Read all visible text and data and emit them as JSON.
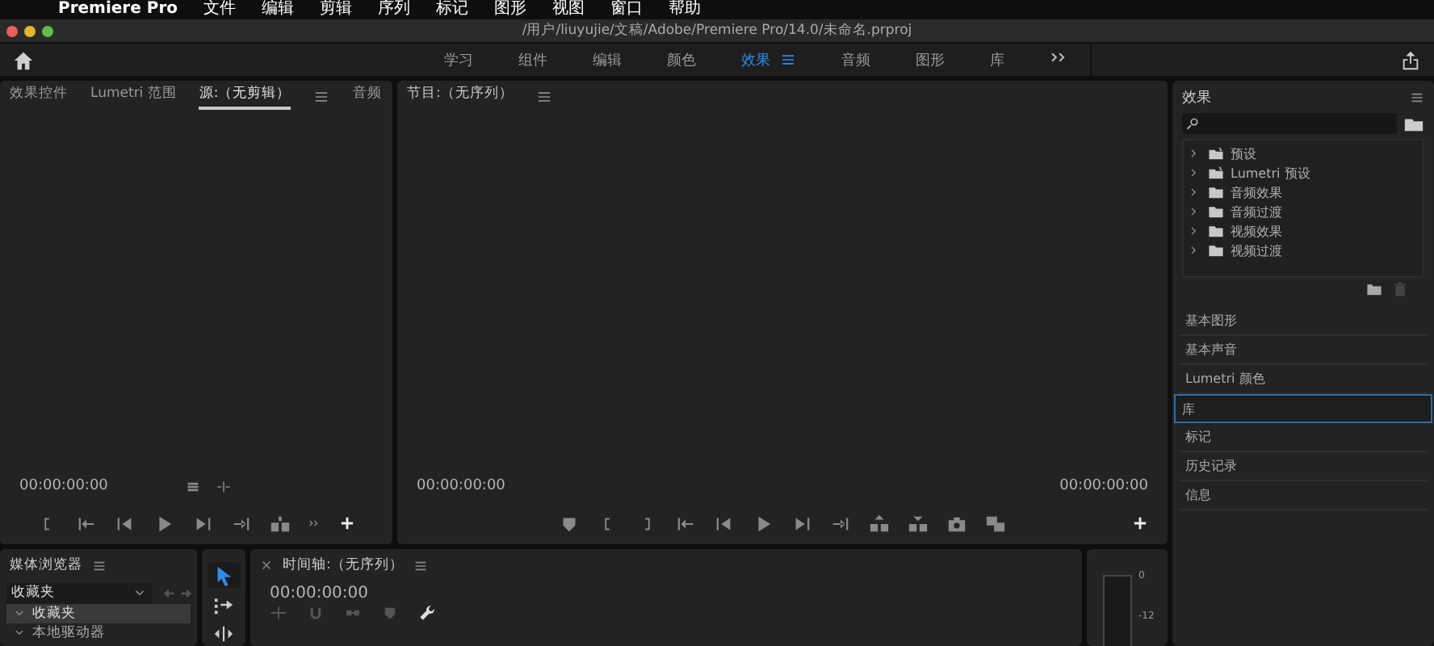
{
  "menu_bar": {
    "app_name": "Premiere Pro",
    "items": [
      "文件",
      "编辑",
      "剪辑",
      "序列",
      "标记",
      "图形",
      "视图",
      "窗口",
      "帮助"
    ]
  },
  "window": {
    "title": "/用户/liuyujie/文稿/Adobe/Premiere Pro/14.0/未命名.prproj"
  },
  "workspaces": [
    {
      "label": "学习",
      "selected": false
    },
    {
      "label": "组件",
      "selected": false
    },
    {
      "label": "编辑",
      "selected": false
    },
    {
      "label": "颜色",
      "selected": false
    },
    {
      "label": "效果",
      "selected": true
    },
    {
      "label": "音频",
      "selected": false
    },
    {
      "label": "图形",
      "selected": false
    },
    {
      "label": "库",
      "selected": false
    }
  ],
  "source_panel": {
    "tabs": [
      {
        "label": "效果控件",
        "selected": false
      },
      {
        "label": "Lumetri 范围",
        "selected": false
      },
      {
        "label": "源:（无剪辑）",
        "selected": true
      },
      {
        "label": "音频",
        "selected": false
      }
    ],
    "timecode": "00:00:00:00"
  },
  "program_panel": {
    "title": "节目:（无序列）",
    "timecode_left": "00:00:00:00",
    "timecode_right": "00:00:00:00"
  },
  "effects_panel": {
    "title": "效果",
    "tree": [
      {
        "label": "预设",
        "kind": "preset",
        "expanded": false
      },
      {
        "label": "Lumetri 预设",
        "kind": "preset",
        "expanded": false
      },
      {
        "label": "音频效果",
        "kind": "folder",
        "expanded": false
      },
      {
        "label": "音频过渡",
        "kind": "folder",
        "expanded": false
      },
      {
        "label": "视频效果",
        "kind": "folder",
        "expanded": false
      },
      {
        "label": "视频过渡",
        "kind": "folder",
        "expanded": false
      }
    ],
    "panels": [
      {
        "label": "基本图形",
        "selected": false
      },
      {
        "label": "基本声音",
        "selected": false
      },
      {
        "label": "Lumetri 颜色",
        "selected": false
      },
      {
        "label": "库",
        "selected": true
      },
      {
        "label": "标记",
        "selected": false
      },
      {
        "label": "历史记录",
        "selected": false
      },
      {
        "label": "信息",
        "selected": false
      }
    ]
  },
  "media_browser": {
    "title": "媒体浏览器",
    "dropdown": "收藏夹",
    "tree": [
      {
        "label": "收藏夹",
        "expanded": true,
        "selected": true
      },
      {
        "label": "本地驱动器",
        "expanded": true,
        "selected": false
      }
    ]
  },
  "tools": [
    {
      "kind": "selection",
      "selected": true
    },
    {
      "kind": "track-select",
      "selected": false
    },
    {
      "kind": "ripple",
      "selected": false
    }
  ],
  "timeline": {
    "title": "时间轴:（无序列）",
    "timecode": "00:00:00:00"
  },
  "audio_meter": {
    "scale": [
      "0",
      "-12"
    ]
  }
}
